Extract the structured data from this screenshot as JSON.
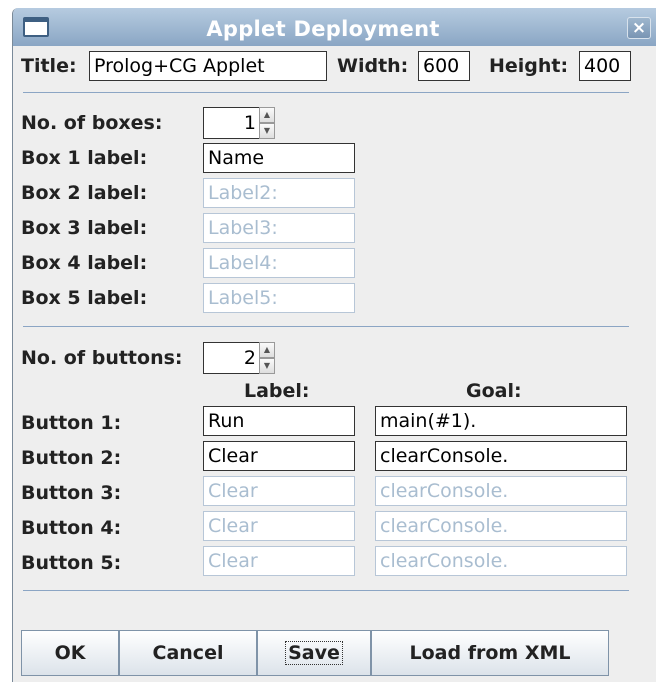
{
  "window": {
    "title": "Applet Deployment",
    "close_glyph": "×"
  },
  "header": {
    "title_label": "Title:",
    "title_value": "Prolog+CG Applet",
    "width_label": "Width:",
    "width_value": "600",
    "height_label": "Height:",
    "height_value": "400"
  },
  "boxes": {
    "count_label": "No. of boxes:",
    "count_value": "1",
    "items": [
      {
        "label": "Box 1 label:",
        "value": "Name",
        "enabled": true
      },
      {
        "label": "Box 2 label:",
        "value": "Label2:",
        "enabled": false
      },
      {
        "label": "Box 3 label:",
        "value": "Label3:",
        "enabled": false
      },
      {
        "label": "Box 4 label:",
        "value": "Label4:",
        "enabled": false
      },
      {
        "label": "Box 5 label:",
        "value": "Label5:",
        "enabled": false
      }
    ]
  },
  "buttons_section": {
    "count_label": "No. of buttons:",
    "count_value": "2",
    "col_label": "Label:",
    "col_goal": "Goal:",
    "items": [
      {
        "label": "Button 1:",
        "text": "Run",
        "goal": "main(#1).",
        "enabled": true
      },
      {
        "label": "Button 2:",
        "text": "Clear",
        "goal": "clearConsole.",
        "enabled": true
      },
      {
        "label": "Button 3:",
        "text": "Clear",
        "goal": "clearConsole.",
        "enabled": false
      },
      {
        "label": "Button 4:",
        "text": "Clear",
        "goal": "clearConsole.",
        "enabled": false
      },
      {
        "label": "Button 5:",
        "text": "Clear",
        "goal": "clearConsole.",
        "enabled": false
      }
    ]
  },
  "actions": {
    "ok": "OK",
    "cancel": "Cancel",
    "save": "Save",
    "load": "Load from XML"
  },
  "icons": {
    "window": "window-icon",
    "close": "close-icon",
    "spin_up": "spin-up-arrow-icon",
    "spin_down": "spin-down-arrow-icon"
  },
  "colors": {
    "titlebar": "#9fb7cf",
    "separator": "#8ba5c4",
    "disabled_text": "#a9bdd0",
    "background": "#eeeeee"
  }
}
